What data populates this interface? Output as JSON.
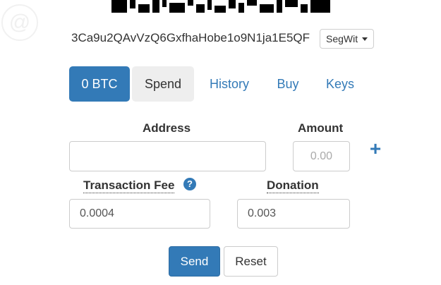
{
  "header": {
    "logo_icon": "at-sign-logo",
    "qr_icon": "qr-code",
    "address": "3Ca9u2QAvVzQ6GxfhaHobe1o9N1ja1E5QF",
    "address_type_label": "SegWit"
  },
  "nav": {
    "balance_label": "0 BTC",
    "spend_label": "Spend",
    "history_label": "History",
    "buy_label": "Buy",
    "keys_label": "Keys"
  },
  "form": {
    "address_label": "Address",
    "address_value": "",
    "amount_label": "Amount",
    "amount_placeholder": "0.00",
    "fee_label": "Transaction Fee",
    "fee_value": "0.0004",
    "donation_label": "Donation",
    "donation_value": "0.003",
    "send_label": "Send",
    "reset_label": "Reset"
  },
  "colors": {
    "primary": "#337ab7",
    "active_tab_bg": "#eeeeee",
    "text": "#333333",
    "border": "#cccccc"
  }
}
